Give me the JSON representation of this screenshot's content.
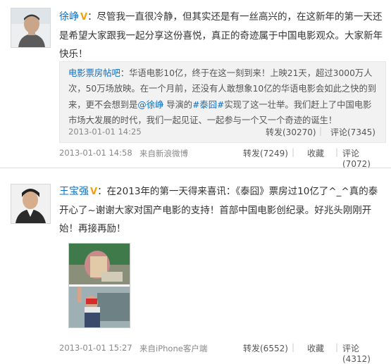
{
  "posts": [
    {
      "author": "徐峥",
      "verified_badge": "V",
      "text": "：尽管我一直很冷静，但其实还是有一丝高兴的，在这新年的第一天还是希望大家跟我一起分享这份喜悦，真正的奇迹属于中国电影观众。大家新年快乐！",
      "quote": {
        "author": "电影票房帖吧",
        "text_1": "：华语电影10亿，终于在这一刻到来！上映21天，超过3000万人次，50万场放映。在一个月前，还没有人敢想象10亿的华语电影会如此之快的到来，更不会想到是",
        "mention": "@徐峥",
        "text_2": " 导演的",
        "topic": "#泰囧#",
        "text_3": "实现了这一壮举。我们赶上了中国电影市场大发展的时代，我们一起见证、一起参与一个又一个奇迹的诞生！",
        "time": "2013-01-01 14:25",
        "repost": "转发(30270)",
        "comment": "评论(7345)"
      },
      "time": "2013-01-01 14:58",
      "source": "来自新浪微博",
      "repost": "转发(7249)",
      "favorite": "收藏",
      "comment": "评论(7072)"
    },
    {
      "author": "王宝强",
      "verified_badge": "V",
      "text": "：在2013年的第一天得来喜讯：《泰囧》票房过10亿了^_^真的泰开心了~谢谢大家对国产电影的支持！首部中国电影创纪录。好兆头刚刚开始！再接再励！",
      "time": "2013-01-01 15:27",
      "source": "来自iPhone客户端",
      "repost": "转发(6552)",
      "favorite": "收藏",
      "comment": "评论(4312)"
    }
  ],
  "separator": "|",
  "colors": {
    "link": "#0a6fc4",
    "badge": "#f1a20b",
    "quote_bg": "#f2f2f2",
    "meta": "#888888"
  }
}
